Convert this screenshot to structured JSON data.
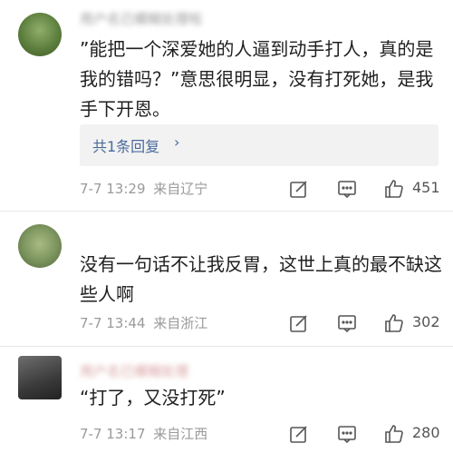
{
  "comments": [
    {
      "username": "用户名已模糊处理啦",
      "text": "”能把一个深爱她的人逼到动手打人，真的是我的错吗？”意思很明显，没有打死她，是我手下开恩。",
      "reply_label": "共1条回复",
      "reply_arrow": "›",
      "time": "7-7 13:29",
      "location": "来自辽宁",
      "likes": "451"
    },
    {
      "username": "",
      "text": "没有一句话不让我反胃，这世上真的最不缺这些人啊",
      "time": "7-7 13:44",
      "location": "来自浙江",
      "likes": "302"
    },
    {
      "username": "用户名已模糊处理",
      "text": "“打了，又没打死”",
      "time": "7-7 13:17",
      "location": "来自江西",
      "likes": "280"
    }
  ],
  "icons": {
    "repost": "edit-square-icon",
    "comment": "comment-icon",
    "like": "thumbs-up-icon"
  },
  "colors": {
    "link": "#4a6a9c",
    "meta": "#9a9a9a",
    "reply_bg": "#f2f2f2"
  }
}
